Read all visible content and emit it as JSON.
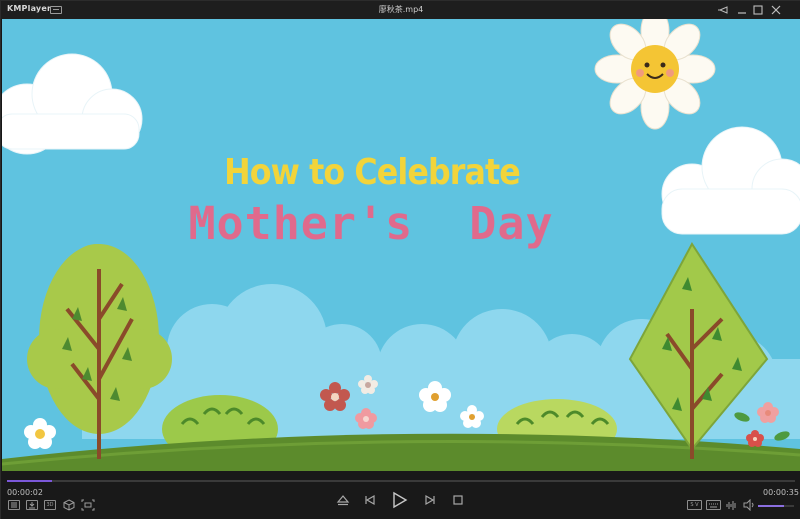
{
  "app": {
    "name": "KMPlayer"
  },
  "window": {
    "file_title": "廖秋茶.mp4",
    "controls": [
      "pin-icon",
      "minimize-icon",
      "maximize-icon",
      "close-icon"
    ]
  },
  "video": {
    "title_line1": "How to Celebrate",
    "title_line2": "Mother's Day"
  },
  "playback": {
    "current_time": "00:00:02",
    "total_time": "00:00:35",
    "progress_fraction": 0.057,
    "volume_fraction": 0.72,
    "left_tools": [
      "playlist-icon",
      "capture-icon",
      "subtitle-3d-icon",
      "cube-3d-icon",
      "vr-icon"
    ],
    "center_buttons": [
      "eject-icon",
      "previous-icon",
      "play-icon",
      "next-icon",
      "stop-icon"
    ],
    "right_tools": [
      "sv-icon",
      "keyboard-icon",
      "equalizer-icon",
      "volume-icon"
    ],
    "right_tool_labels": {
      "sv": "S V"
    },
    "left_tool_labels": {
      "subtitle3d": "3D"
    }
  },
  "colors": {
    "accent": "#7b58d9",
    "sky": "#5fc3e0",
    "title_yellow": "#f2d43a",
    "title_pink": "#e06a8c"
  }
}
